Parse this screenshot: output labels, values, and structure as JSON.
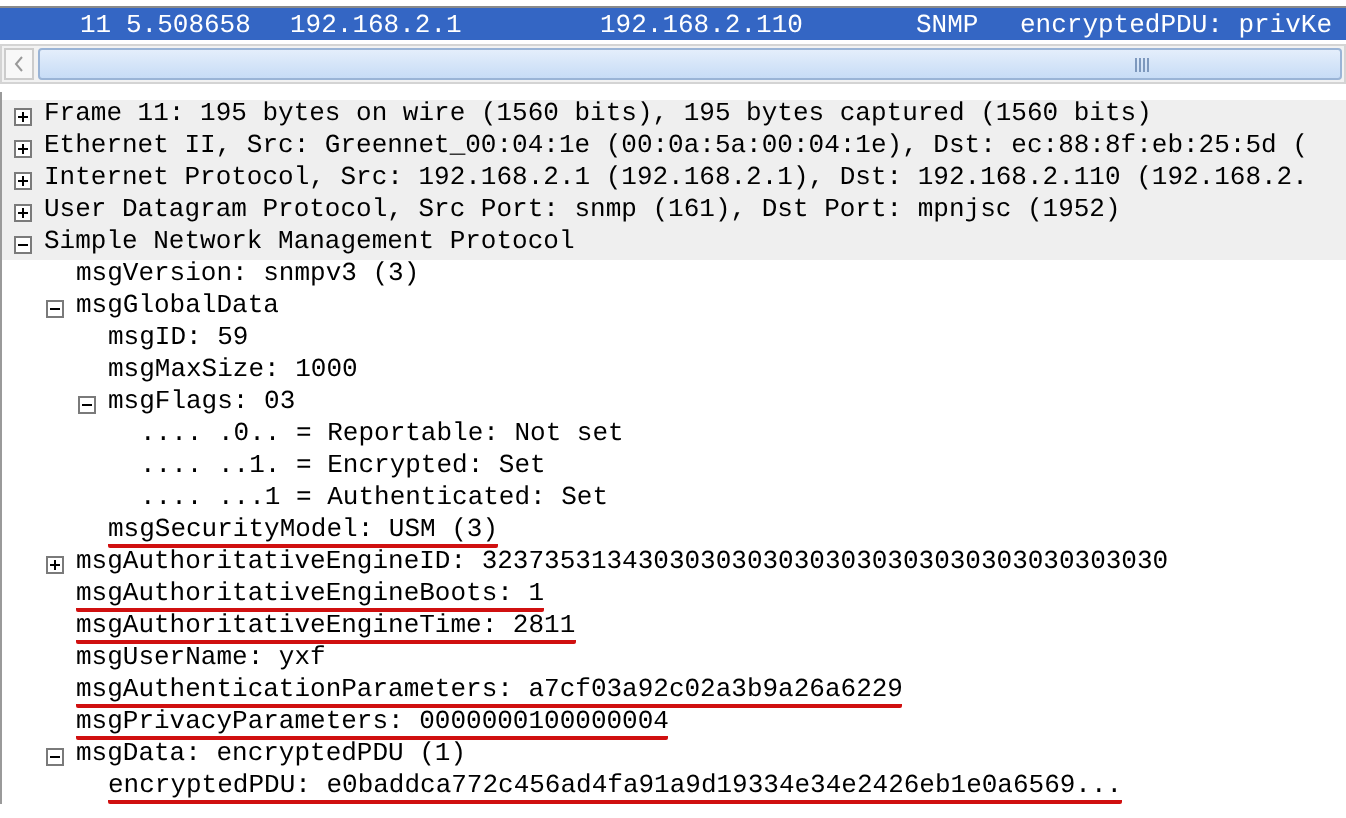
{
  "packet_row": {
    "selected": true,
    "no": "11",
    "time": "5.508658",
    "source": "192.168.2.1",
    "destination": "192.168.2.110",
    "protocol": "SNMP",
    "info": "encryptedPDU: privKe"
  },
  "tree": [
    {
      "label": "Frame 11: 195 bytes on wire (1560 bits), 195 bytes captured (1560 bits)",
      "expanded": false
    },
    {
      "label": "Ethernet II, Src: Greennet_00:04:1e (00:0a:5a:00:04:1e), Dst: ec:88:8f:eb:25:5d (",
      "expanded": false
    },
    {
      "label": "Internet Protocol, Src: 192.168.2.1 (192.168.2.1), Dst: 192.168.2.110 (192.168.2.",
      "expanded": false
    },
    {
      "label": "User Datagram Protocol, Src Port: snmp (161), Dst Port: mpnjsc (1952)",
      "expanded": false
    },
    {
      "label": "Simple Network Management Protocol",
      "expanded": true,
      "children": [
        {
          "label": "msgVersion: snmpv3 (3)"
        },
        {
          "label": "msgGlobalData",
          "expanded": true,
          "children": [
            {
              "label": "msgID: 59"
            },
            {
              "label": "msgMaxSize: 1000"
            },
            {
              "label": "msgFlags: 03",
              "expanded": true,
              "children": [
                {
                  "label": ".... .0.. = Reportable: Not set"
                },
                {
                  "label": ".... ..1. = Encrypted: Set"
                },
                {
                  "label": ".... ...1 = Authenticated: Set"
                }
              ]
            },
            {
              "label": "msgSecurityModel: USM (3)",
              "underlined": true
            }
          ]
        },
        {
          "label": "msgAuthoritativeEngineID: 32373531343030303030303030303030303030303030",
          "expanded": false
        },
        {
          "label": "msgAuthoritativeEngineBoots: 1",
          "underlined": true
        },
        {
          "label": "msgAuthoritativeEngineTime: 2811",
          "underlined": true
        },
        {
          "label": "msgUserName: yxf"
        },
        {
          "label": "msgAuthenticationParameters: a7cf03a92c02a3b9a26a6229",
          "underlined": true
        },
        {
          "label": "msgPrivacyParameters: 0000000100000004",
          "underlined": true
        },
        {
          "label": "msgData: encryptedPDU (1)",
          "expanded": true,
          "children": [
            {
              "label": "encryptedPDU: e0baddca772c456ad4fa91a9d19334e34e2426eb1e0a6569...",
              "underlined": true
            }
          ]
        }
      ]
    }
  ]
}
